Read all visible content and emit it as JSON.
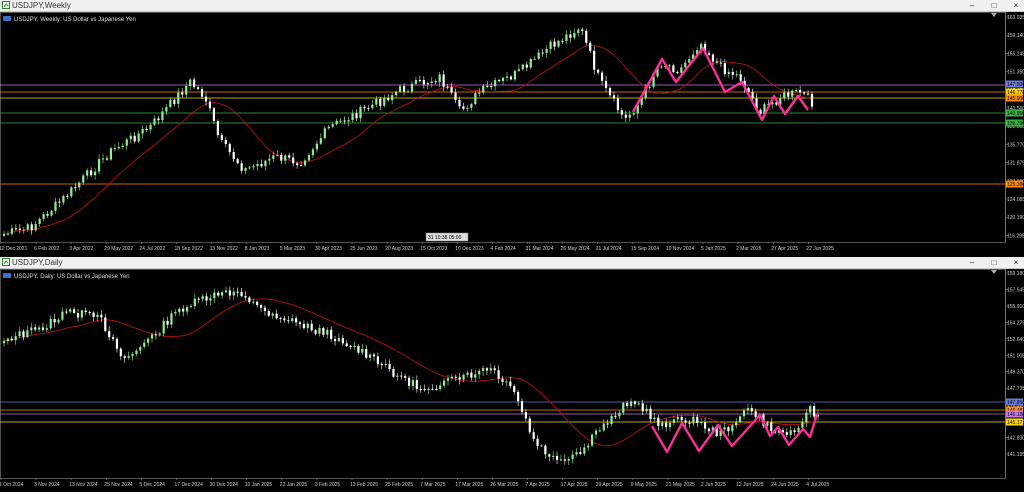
{
  "colors": {
    "bull": "#90ee90",
    "bear": "#ffffff",
    "ma": "#cc1111",
    "zigzag": "#ff2d9a",
    "orange": "#ff8c00",
    "yellow": "#ffd700",
    "green": "#3cb043",
    "blue": "#6a7ad8",
    "purple": "#c37ae8",
    "axis": "#cfcfcf",
    "grid": "#555"
  },
  "top": {
    "title": "USDJPY,Weekly",
    "label": "USDJPY, Weekly: US Dollar vs Japanese Yen",
    "date_badge": "31 10:38  05:00",
    "minimize": "–",
    "maximize": "□",
    "close": "×",
    "price_labels": [
      "163.035",
      "159.140",
      "155.245",
      "151.350",
      "147.455",
      "143.560",
      "139.665",
      "135.770",
      "131.875",
      "127.980",
      "124.085",
      "120.190",
      "116.295"
    ],
    "date_labels": [
      "12 Dec 2021",
      "6 Feb 2022",
      "3 Apr 2022",
      "29 May 2022",
      "24 Jul 2022",
      "18 Sep 2022",
      "13 Nov 2022",
      "8 Jan 2023",
      "5 Mar 2023",
      "30 Apr 2023",
      "25 Jun 2023",
      "20 Aug 2023",
      "15 Oct 2023",
      "10 Dec 2023",
      "4 Feb 2024",
      "31 Mar 2024",
      "26 May 2024",
      "21 Jul 2024",
      "15 Sep 2024",
      "10 Nov 2024",
      "5 Jan 2025",
      "2 Mar 2025",
      "27 Apr 2025",
      "22 Jun 2025"
    ],
    "level_tags": [
      {
        "text": "147.500",
        "color": "#6a7ad8"
      },
      {
        "text": "146.778",
        "color": "#ffd700"
      },
      {
        "text": "145.900",
        "color": "#ff8c00"
      },
      {
        "text": "140.950",
        "color": "#3cb043"
      },
      {
        "text": "139.700",
        "color": "#3cb043"
      },
      {
        "text": "125.380",
        "color": "#ff8c00"
      }
    ]
  },
  "bottom": {
    "title": "USDJPY,Daily",
    "label": "USDJPY, Daily: US Dollar vs Japanese Yen",
    "minimize": "–",
    "maximize": "□",
    "close": "×",
    "price_labels": [
      "159.180",
      "157.545",
      "155.910",
      "154.275",
      "152.640",
      "151.005",
      "149.370",
      "147.735",
      "146.100",
      "144.465",
      "142.830",
      "141.195"
    ],
    "date_labels": [
      "1 Oct 2024",
      "3 Nov 2024",
      "13 Nov 2024",
      "25 Nov 2024",
      "5 Dec 2024",
      "17 Dec 2024",
      "30 Dec 2024",
      "10 Jan 2025",
      "22 Jan 2025",
      "3 Feb 2025",
      "13 Feb 2025",
      "25 Feb 2025",
      "7 Mar 2025",
      "17 Mar 2025",
      "26 Mar 2025",
      "7 Apr 2025",
      "17 Apr 2025",
      "29 Apr 2025",
      "9 May 2025",
      "21 May 2025",
      "2 Jun 2025",
      "12 Jun 2025",
      "24 Jun 2025",
      "4 Jul 2025"
    ],
    "level_tags": [
      {
        "text": "147.856",
        "color": "#6a7ad8"
      },
      {
        "text": "146.481",
        "color": "#ff8c00"
      },
      {
        "text": "146.188",
        "color": "#c37ae8"
      },
      {
        "text": "145.177",
        "color": "#ffd700"
      }
    ]
  }
}
